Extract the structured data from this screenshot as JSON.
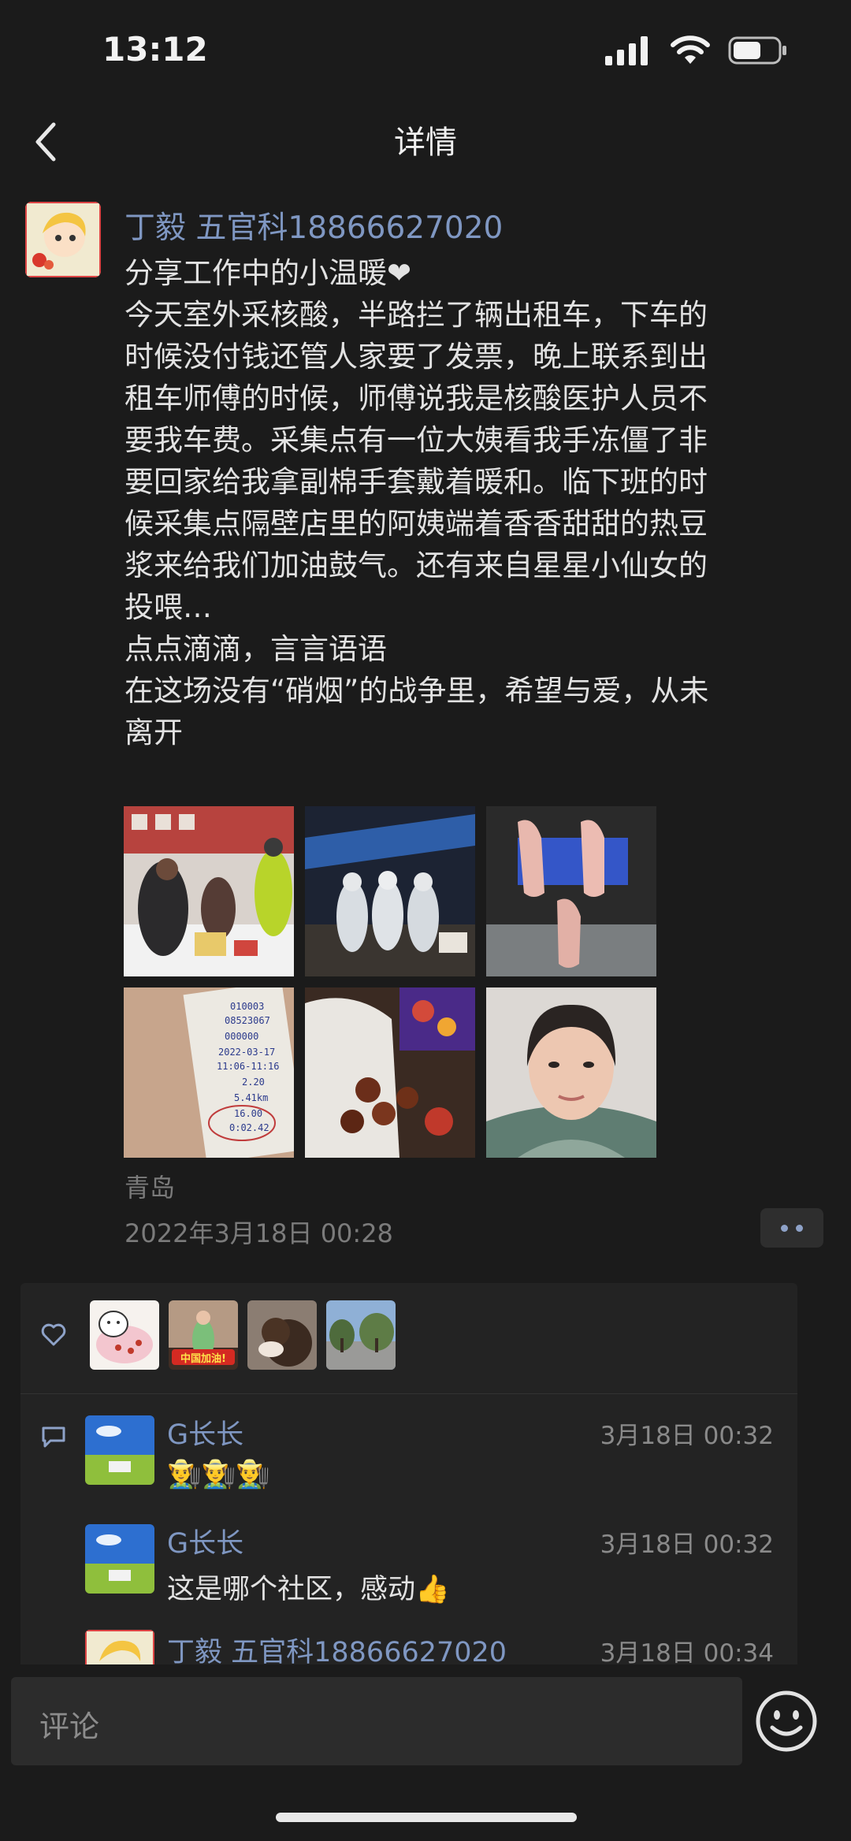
{
  "status_bar": {
    "time": "13:12"
  },
  "nav": {
    "title": "详情"
  },
  "post": {
    "author": "丁毅 五官科18866627020",
    "lines": [
      "分享工作中的小温暖❤",
      "今天室外采核酸，半路拦了辆出租车，下车的",
      "时候没付钱还管人家要了发票，晚上联系到出",
      "租车师傅的时候，师傅说我是核酸医护人员不",
      "要我车费。采集点有一位大姨看我手冻僵了非",
      "要回家给我拿副棉手套戴着暖和。临下班的时",
      "候采集点隔壁店里的阿姨端着香香甜甜的热豆",
      "浆来给我们加油鼓气。还有来自星星小仙女的",
      "投喂…",
      "点点滴滴，言言语语",
      "在这场没有“硝烟”的战争里，希望与爱，从未",
      "离开"
    ],
    "location": "青岛",
    "date": "2022年3月18日 00:28",
    "receipt_text": [
      "010003",
      "08523067",
      "000000",
      "2022-03-17",
      "11:06-11:16",
      "2.20",
      "5.41km",
      "16.00",
      "0:02.42"
    ]
  },
  "likes": {
    "badge_text": "中国加油!"
  },
  "comments": [
    {
      "name": "G长长",
      "time": "3月18日 00:32",
      "text": "👨‍🌾👨‍🌾👨‍🌾"
    },
    {
      "name": "G长长",
      "time": "3月18日 00:32",
      "text": "这是哪个社区，感动👍"
    },
    {
      "name": "丁毅 五官科18866627020",
      "time": "3月18日 00:34",
      "text": ""
    }
  ],
  "input": {
    "placeholder": "评论"
  },
  "colors": {
    "background": "#1b1b1b",
    "link": "#7f97c2",
    "secondary": "#7b7b7b"
  }
}
